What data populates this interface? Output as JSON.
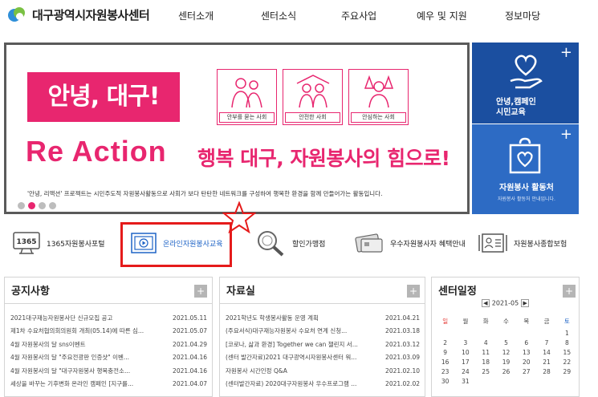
{
  "header": {
    "logo_text": "대구광역시자원봉사센터",
    "nav": [
      "센터소개",
      "센터소식",
      "주요사업",
      "예우 및 지원",
      "정보마당"
    ]
  },
  "banner": {
    "hello": "안녕, 대구!",
    "reaction": "Re Action",
    "slogan": "행복 대구, 자원봉사의 힘으로!",
    "pictograms": [
      "안부를 묻는 사회",
      "안전한 사회",
      "안심하는 사회"
    ],
    "description": "'안녕, 리액션' 프로젝트는 시민주도적 자원봉사활동으로 사회가 보다 탄탄한 네트워크를 구성하여 행복한 환경을 함께 만들어가는 활동입니다.",
    "slide_count": 4,
    "active_slide": 2
  },
  "tiles": [
    {
      "label_line1": "안녕,캠페인",
      "label_line2": "시민교육",
      "icon": "heart-hand-icon"
    },
    {
      "label_line1": "자원봉사 활동처",
      "sub": "자원봉사 활동처 안내입니다.",
      "icon": "heart-bag-icon"
    }
  ],
  "quick_links": [
    {
      "label": "1365자원봉사포털",
      "icon": "1365-monitor-icon"
    },
    {
      "label": "온라인자원봉사교육",
      "icon": "video-play-icon"
    },
    {
      "label": "할인가맹점",
      "icon": "magnifier-icon"
    },
    {
      "label": "우수자원봉사자 혜택안내",
      "icon": "card-icon"
    },
    {
      "label": "자원봉사종합보험",
      "icon": "id-card-icon"
    }
  ],
  "notice": {
    "title": "공지사항",
    "rows": [
      {
        "title": "2021대구재능자원봉사단 신규모집 공고",
        "date": "2021.05.11"
      },
      {
        "title": "제1차 수요처협의회의원회 개최(05.14)에 따른 심...",
        "date": "2021.05.07"
      },
      {
        "title": "4월 자원봉사의 달 sns이벤트",
        "date": "2021.04.29"
      },
      {
        "title": "4월 자원봉사의 달 \"주요전광판 인증샷\" 이벤...",
        "date": "2021.04.16"
      },
      {
        "title": "4월 자원봉사의 달 \"대구자원봉사 행복충전소...",
        "date": "2021.04.16"
      },
      {
        "title": "세상을 바꾸는 기후변화 온라인 캠페인 [지구를...",
        "date": "2021.04.07"
      }
    ]
  },
  "library": {
    "title": "자료실",
    "rows": [
      {
        "title": "2021학년도 학생봉사활동 운영 계획",
        "date": "2021.04.21"
      },
      {
        "title": "(주요서식)대구재능자원봉사 수요처 연계 신청...",
        "date": "2021.03.18"
      },
      {
        "title": "[코로나, 삶과 환경] Together we can 챌린지 서...",
        "date": "2021.03.12"
      },
      {
        "title": "(센터 발간자료)2021 대구광역시자원봉사센터 워...",
        "date": "2021.03.09"
      },
      {
        "title": "자원봉사 시간인정 Q&A",
        "date": "2021.02.10"
      },
      {
        "title": "(센터발간자료) 2020대구자원봉사 우수프로그램 ...",
        "date": "2021.02.02"
      }
    ]
  },
  "calendar": {
    "title": "센터일정",
    "month": "2021-05",
    "weekdays": [
      "일",
      "월",
      "화",
      "수",
      "목",
      "금",
      "토"
    ],
    "weeks": [
      [
        "",
        "",
        "",
        "",
        "",
        "",
        "1"
      ],
      [
        "2",
        "3",
        "4",
        "5",
        "6",
        "7",
        "8"
      ],
      [
        "9",
        "10",
        "11",
        "12",
        "13",
        "14",
        "15"
      ],
      [
        "16",
        "17",
        "18",
        "19",
        "20",
        "21",
        "22"
      ],
      [
        "23",
        "24",
        "25",
        "26",
        "27",
        "28",
        "29"
      ],
      [
        "30",
        "31",
        "",
        "",
        "",
        "",
        ""
      ]
    ]
  },
  "colors": {
    "accent": "#e8266f",
    "tile_dark": "#1b4fa0",
    "tile_light": "#2d6bc4",
    "highlight": "#e51b1b"
  }
}
